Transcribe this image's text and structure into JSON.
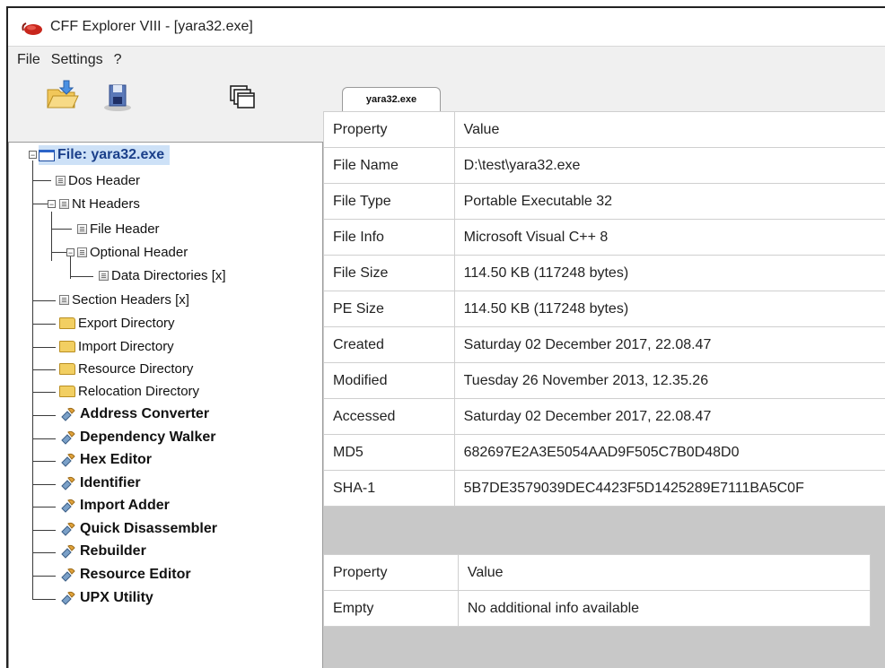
{
  "window": {
    "title": "CFF Explorer VIII - [yara32.exe]"
  },
  "menu": [
    "File",
    "Settings",
    "?"
  ],
  "toolbar": {
    "icons": [
      "open-icon",
      "save-icon",
      "windows-icon"
    ]
  },
  "tree": {
    "root": "File: yara32.exe",
    "items": [
      {
        "label": "Dos Header",
        "icon": "doc-icon",
        "bold": false
      },
      {
        "label": "Nt Headers",
        "icon": "doc-icon",
        "bold": false
      },
      {
        "label": "File Header",
        "icon": "doc-icon",
        "bold": false
      },
      {
        "label": "Optional Header",
        "icon": "doc-icon",
        "bold": false
      },
      {
        "label": "Data Directories [x]",
        "icon": "doc-icon",
        "bold": false
      },
      {
        "label": "Section Headers [x]",
        "icon": "doc-icon",
        "bold": false
      },
      {
        "label": "Export Directory",
        "icon": "folder-icon",
        "bold": false
      },
      {
        "label": "Import Directory",
        "icon": "folder-icon",
        "bold": false
      },
      {
        "label": "Resource Directory",
        "icon": "folder-icon",
        "bold": false
      },
      {
        "label": "Relocation Directory",
        "icon": "folder-icon",
        "bold": false
      },
      {
        "label": "Address Converter",
        "icon": "tool-icon",
        "bold": true
      },
      {
        "label": "Dependency Walker",
        "icon": "tool-icon",
        "bold": true
      },
      {
        "label": "Hex Editor",
        "icon": "tool-icon",
        "bold": true
      },
      {
        "label": "Identifier",
        "icon": "tool-icon",
        "bold": true
      },
      {
        "label": "Import Adder",
        "icon": "tool-icon",
        "bold": true
      },
      {
        "label": "Quick Disassembler",
        "icon": "tool-icon",
        "bold": true
      },
      {
        "label": "Rebuilder",
        "icon": "tool-icon",
        "bold": true
      },
      {
        "label": "Resource Editor",
        "icon": "tool-icon",
        "bold": true
      },
      {
        "label": "UPX Utility",
        "icon": "tool-icon",
        "bold": true
      }
    ]
  },
  "tab": {
    "label": "yara32.exe"
  },
  "props": {
    "headers": [
      "Property",
      "Value"
    ],
    "rows": [
      [
        "File Name",
        "D:\\test\\yara32.exe"
      ],
      [
        "File Type",
        "Portable Executable 32"
      ],
      [
        "File Info",
        "Microsoft Visual C++ 8"
      ],
      [
        "File Size",
        "114.50 KB (117248 bytes)"
      ],
      [
        "PE Size",
        "114.50 KB (117248 bytes)"
      ],
      [
        "Created",
        "Saturday 02 December 2017, 22.08.47"
      ],
      [
        "Modified",
        "Tuesday 26 November 2013, 12.35.26"
      ],
      [
        "Accessed",
        "Saturday 02 December 2017, 22.08.47"
      ],
      [
        "MD5",
        "682697E2A3E5054AAD9F505C7B0D48D0"
      ],
      [
        "SHA-1",
        "5B7DE3579039DEC4423F5D1425289E7111BA5C0F"
      ]
    ]
  },
  "info": {
    "headers": [
      "Property",
      "Value"
    ],
    "rows": [
      [
        "Empty",
        "No additional info available"
      ]
    ]
  }
}
